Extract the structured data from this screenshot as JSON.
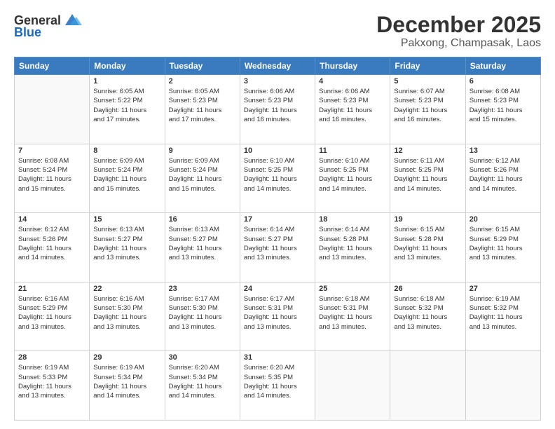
{
  "header": {
    "logo_general": "General",
    "logo_blue": "Blue",
    "title": "December 2025",
    "subtitle": "Pakxong, Champasak, Laos"
  },
  "calendar": {
    "weekdays": [
      "Sunday",
      "Monday",
      "Tuesday",
      "Wednesday",
      "Thursday",
      "Friday",
      "Saturday"
    ],
    "weeks": [
      [
        {
          "day": "",
          "info": ""
        },
        {
          "day": "1",
          "info": "Sunrise: 6:05 AM\nSunset: 5:22 PM\nDaylight: 11 hours\nand 17 minutes."
        },
        {
          "day": "2",
          "info": "Sunrise: 6:05 AM\nSunset: 5:23 PM\nDaylight: 11 hours\nand 17 minutes."
        },
        {
          "day": "3",
          "info": "Sunrise: 6:06 AM\nSunset: 5:23 PM\nDaylight: 11 hours\nand 16 minutes."
        },
        {
          "day": "4",
          "info": "Sunrise: 6:06 AM\nSunset: 5:23 PM\nDaylight: 11 hours\nand 16 minutes."
        },
        {
          "day": "5",
          "info": "Sunrise: 6:07 AM\nSunset: 5:23 PM\nDaylight: 11 hours\nand 16 minutes."
        },
        {
          "day": "6",
          "info": "Sunrise: 6:08 AM\nSunset: 5:23 PM\nDaylight: 11 hours\nand 15 minutes."
        }
      ],
      [
        {
          "day": "7",
          "info": "Sunrise: 6:08 AM\nSunset: 5:24 PM\nDaylight: 11 hours\nand 15 minutes."
        },
        {
          "day": "8",
          "info": "Sunrise: 6:09 AM\nSunset: 5:24 PM\nDaylight: 11 hours\nand 15 minutes."
        },
        {
          "day": "9",
          "info": "Sunrise: 6:09 AM\nSunset: 5:24 PM\nDaylight: 11 hours\nand 15 minutes."
        },
        {
          "day": "10",
          "info": "Sunrise: 6:10 AM\nSunset: 5:25 PM\nDaylight: 11 hours\nand 14 minutes."
        },
        {
          "day": "11",
          "info": "Sunrise: 6:10 AM\nSunset: 5:25 PM\nDaylight: 11 hours\nand 14 minutes."
        },
        {
          "day": "12",
          "info": "Sunrise: 6:11 AM\nSunset: 5:25 PM\nDaylight: 11 hours\nand 14 minutes."
        },
        {
          "day": "13",
          "info": "Sunrise: 6:12 AM\nSunset: 5:26 PM\nDaylight: 11 hours\nand 14 minutes."
        }
      ],
      [
        {
          "day": "14",
          "info": "Sunrise: 6:12 AM\nSunset: 5:26 PM\nDaylight: 11 hours\nand 14 minutes."
        },
        {
          "day": "15",
          "info": "Sunrise: 6:13 AM\nSunset: 5:27 PM\nDaylight: 11 hours\nand 13 minutes."
        },
        {
          "day": "16",
          "info": "Sunrise: 6:13 AM\nSunset: 5:27 PM\nDaylight: 11 hours\nand 13 minutes."
        },
        {
          "day": "17",
          "info": "Sunrise: 6:14 AM\nSunset: 5:27 PM\nDaylight: 11 hours\nand 13 minutes."
        },
        {
          "day": "18",
          "info": "Sunrise: 6:14 AM\nSunset: 5:28 PM\nDaylight: 11 hours\nand 13 minutes."
        },
        {
          "day": "19",
          "info": "Sunrise: 6:15 AM\nSunset: 5:28 PM\nDaylight: 11 hours\nand 13 minutes."
        },
        {
          "day": "20",
          "info": "Sunrise: 6:15 AM\nSunset: 5:29 PM\nDaylight: 11 hours\nand 13 minutes."
        }
      ],
      [
        {
          "day": "21",
          "info": "Sunrise: 6:16 AM\nSunset: 5:29 PM\nDaylight: 11 hours\nand 13 minutes."
        },
        {
          "day": "22",
          "info": "Sunrise: 6:16 AM\nSunset: 5:30 PM\nDaylight: 11 hours\nand 13 minutes."
        },
        {
          "day": "23",
          "info": "Sunrise: 6:17 AM\nSunset: 5:30 PM\nDaylight: 11 hours\nand 13 minutes."
        },
        {
          "day": "24",
          "info": "Sunrise: 6:17 AM\nSunset: 5:31 PM\nDaylight: 11 hours\nand 13 minutes."
        },
        {
          "day": "25",
          "info": "Sunrise: 6:18 AM\nSunset: 5:31 PM\nDaylight: 11 hours\nand 13 minutes."
        },
        {
          "day": "26",
          "info": "Sunrise: 6:18 AM\nSunset: 5:32 PM\nDaylight: 11 hours\nand 13 minutes."
        },
        {
          "day": "27",
          "info": "Sunrise: 6:19 AM\nSunset: 5:32 PM\nDaylight: 11 hours\nand 13 minutes."
        }
      ],
      [
        {
          "day": "28",
          "info": "Sunrise: 6:19 AM\nSunset: 5:33 PM\nDaylight: 11 hours\nand 13 minutes."
        },
        {
          "day": "29",
          "info": "Sunrise: 6:19 AM\nSunset: 5:34 PM\nDaylight: 11 hours\nand 14 minutes."
        },
        {
          "day": "30",
          "info": "Sunrise: 6:20 AM\nSunset: 5:34 PM\nDaylight: 11 hours\nand 14 minutes."
        },
        {
          "day": "31",
          "info": "Sunrise: 6:20 AM\nSunset: 5:35 PM\nDaylight: 11 hours\nand 14 minutes."
        },
        {
          "day": "",
          "info": ""
        },
        {
          "day": "",
          "info": ""
        },
        {
          "day": "",
          "info": ""
        }
      ]
    ]
  }
}
